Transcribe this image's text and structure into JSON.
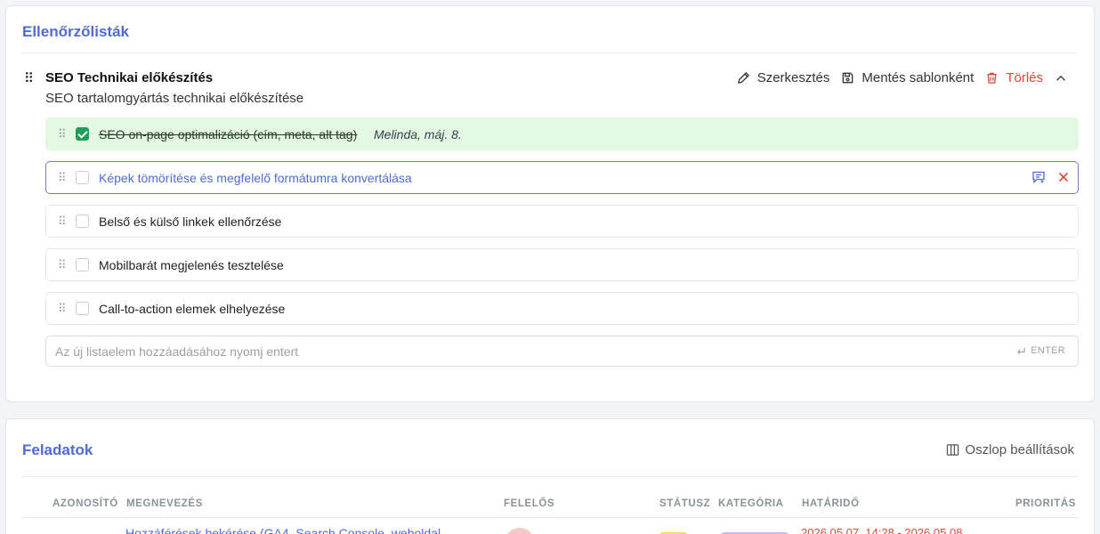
{
  "checklists": {
    "section_title": "Ellenőrzőlisták",
    "checklist": {
      "title": "SEO Technikai előkészítés",
      "subtitle": "SEO tartalomgyártás technikai előkészítése",
      "actions": {
        "edit_label": "Szerkesztés",
        "save_template_label": "Mentés sablonként",
        "delete_label": "Törlés"
      },
      "items": [
        {
          "text": "SEO on-page optimalizáció (cím, meta, alt tag)",
          "done": true,
          "meta": "Melinda, máj. 8."
        },
        {
          "text": "Képek tömörítése és megfelelő formátumra konvertálása",
          "done": false,
          "active": true
        },
        {
          "text": "Belső és külső linkek ellenőrzése",
          "done": false
        },
        {
          "text": "Mobilbarát megjelenés tesztelése",
          "done": false
        },
        {
          "text": "Call-to-action elemek elhelyezése",
          "done": false
        }
      ],
      "new_item": {
        "placeholder": "Az új listaelem hozzáadásához nyomj entert",
        "value": "",
        "enter_hint": "ENTER"
      }
    }
  },
  "tasks": {
    "section_title": "Feladatok",
    "column_settings_label": "Oszlop beállítások",
    "columns": {
      "id": "AZONOSÍTÓ",
      "name": "MEGNEVEZÉS",
      "owner": "FELELŐS",
      "status": "STÁTUSZ",
      "category": "KATEGÓRIA",
      "deadline": "HATÁRIDŐ",
      "priority": "PRIORITÁS"
    },
    "rows": [
      {
        "name": "Hozzáférések bekérése (GA4, Search Console, weboldal",
        "deadline": "2026.05.07. 14:28 - 2026.05.08."
      }
    ]
  },
  "colors": {
    "accent": "#4f6bd4",
    "danger": "#d94a38",
    "done_bg": "#e2f8e0",
    "check_green": "#1e9e5a"
  },
  "icons": [
    "drag-handle-icon",
    "pencil-icon",
    "save-icon",
    "trash-icon",
    "chevron-up-icon",
    "comment-add-icon",
    "close-icon",
    "enter-icon",
    "columns-icon"
  ]
}
